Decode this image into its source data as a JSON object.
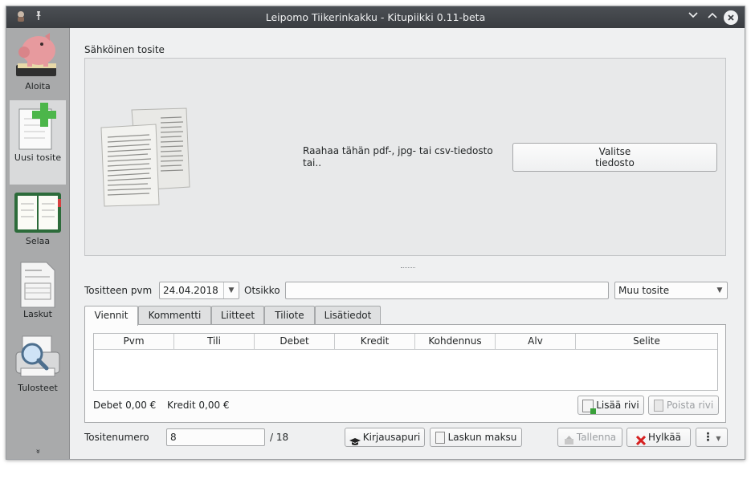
{
  "window": {
    "title": "Leipomo Tiikerinkakku - Kitupiikki 0.11-beta"
  },
  "sidebar": {
    "items": [
      {
        "label": "Aloita",
        "icon": "piggy-bank-icon"
      },
      {
        "label": "Uusi tosite",
        "icon": "new-document-icon"
      },
      {
        "label": "Selaa",
        "icon": "ledger-book-icon"
      },
      {
        "label": "Laskut",
        "icon": "invoice-icon"
      },
      {
        "label": "Tulosteet",
        "icon": "print-preview-icon"
      }
    ],
    "more": "»"
  },
  "attachment": {
    "heading": "Sähköinen tosite",
    "drop_text": "Raahaa tähän pdf-, jpg- tai csv-tiedosto tai..",
    "choose_button": "Valitse tiedosto"
  },
  "voucher": {
    "date_label": "Tositteen pvm",
    "date_value": "24.04.2018",
    "title_label": "Otsikko",
    "title_value": "",
    "type_value": "Muu tosite"
  },
  "tabs": [
    "Viennit",
    "Kommentti",
    "Liitteet",
    "Tiliote",
    "Lisätiedot"
  ],
  "entries": {
    "columns": [
      "Pvm",
      "Tili",
      "Debet",
      "Kredit",
      "Kohdennus",
      "Alv",
      "Selite"
    ],
    "debit_total": "Debet 0,00 €",
    "credit_total": "Kredit 0,00 €",
    "add_row": "Lisää rivi",
    "remove_row": "Poista rivi"
  },
  "footer": {
    "number_label": "Tositenumero",
    "number_value": "8",
    "number_total": "/ 18",
    "wizard_button": "Kirjausapuri",
    "invoice_payment_button": "Laskun maksu",
    "save_button": "Tallenna",
    "discard_button": "Hylkää",
    "menu_button": "⋮"
  },
  "colors": {
    "titlebar": "#3a3d41",
    "sidebar": "#a9aaab",
    "window_bg": "#eff0f1",
    "discard_icon": "#d62020",
    "add_icon": "#3aa13a"
  }
}
